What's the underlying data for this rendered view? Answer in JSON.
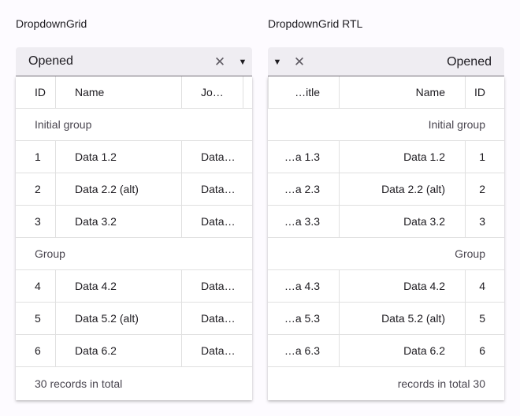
{
  "ltr": {
    "title": "DropdownGrid",
    "value": "Opened",
    "clear_symbol": "✕",
    "caret_symbol": "▼",
    "columns": [
      "ID",
      "Name",
      "Jo…"
    ],
    "groups": [
      {
        "label": "Initial group",
        "rows": [
          {
            "id": "1",
            "name": "Data 1.2",
            "third": "Data…"
          },
          {
            "id": "2",
            "name": "Data 2.2 (alt)",
            "third": "Data…"
          },
          {
            "id": "3",
            "name": "Data 3.2",
            "third": "Data…"
          }
        ]
      },
      {
        "label": "Group",
        "rows": [
          {
            "id": "4",
            "name": "Data 4.2",
            "third": "Data…"
          },
          {
            "id": "5",
            "name": "Data 5.2 (alt)",
            "third": "Data…"
          },
          {
            "id": "6",
            "name": "Data 6.2",
            "third": "Data…"
          }
        ]
      }
    ],
    "footer": "30 records in total"
  },
  "rtl": {
    "title": "DropdownGrid RTL",
    "value": "Opened",
    "clear_symbol": "✕",
    "caret_symbol": "▼",
    "columns": [
      "ID",
      "Name",
      "…itle"
    ],
    "groups": [
      {
        "label": "Initial group",
        "rows": [
          {
            "id": "1",
            "name": "Data 1.2",
            "third": "…a 1.3"
          },
          {
            "id": "2",
            "name": "Data 2.2 (alt)",
            "third": "…a 2.3"
          },
          {
            "id": "3",
            "name": "Data 3.2",
            "third": "…a 3.3"
          }
        ]
      },
      {
        "label": "Group",
        "rows": [
          {
            "id": "4",
            "name": "Data 4.2",
            "third": "…a 4.3"
          },
          {
            "id": "5",
            "name": "Data 5.2 (alt)",
            "third": "…a 5.3"
          },
          {
            "id": "6",
            "name": "Data 6.2",
            "third": "…a 6.3"
          }
        ]
      }
    ],
    "footer": "records in total 30"
  }
}
